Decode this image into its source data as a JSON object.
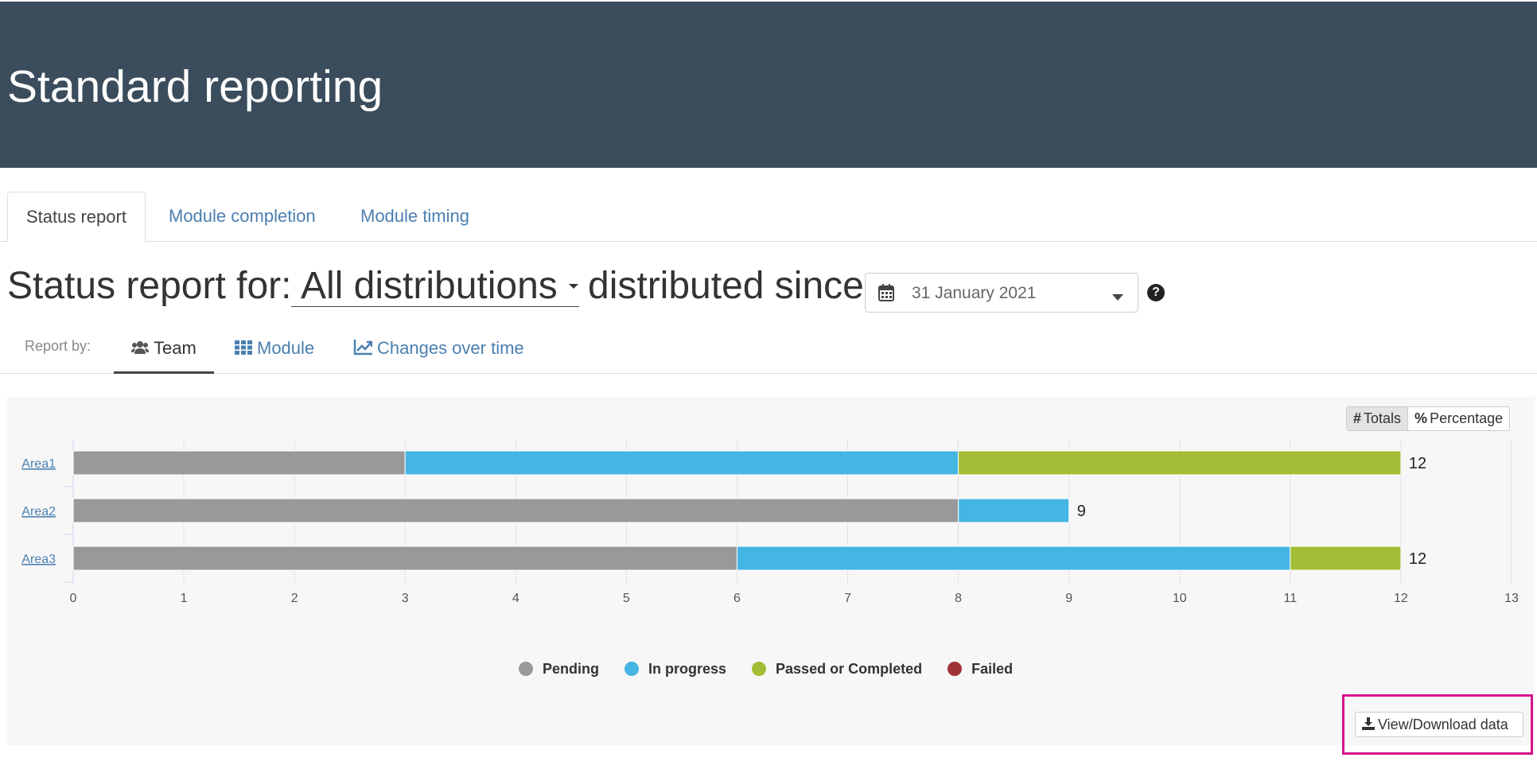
{
  "header": {
    "title": "Standard reporting"
  },
  "tabs": [
    {
      "label": "Status report",
      "active": true
    },
    {
      "label": "Module completion",
      "active": false
    },
    {
      "label": "Module timing",
      "active": false
    }
  ],
  "report": {
    "prefix": "Status report for:",
    "distribution": "All distributions",
    "since_label": "distributed since",
    "date": "31 January 2021"
  },
  "report_by": {
    "label": "Report by:",
    "items": [
      {
        "label": "Team",
        "icon": "users-icon",
        "active": true
      },
      {
        "label": "Module",
        "icon": "grid-icon",
        "active": false
      },
      {
        "label": "Changes over time",
        "icon": "line-chart-icon",
        "active": false
      }
    ]
  },
  "view_toggle": {
    "totals_symbol": "#",
    "totals": "Totals",
    "percent_symbol": "%",
    "percentage": "Percentage",
    "selected": "Totals"
  },
  "chart_data": {
    "type": "bar",
    "orientation": "horizontal",
    "stacked": true,
    "categories": [
      "Area1",
      "Area2",
      "Area3"
    ],
    "series": [
      {
        "name": "Pending",
        "color": "#999999",
        "values": [
          3,
          8,
          6
        ]
      },
      {
        "name": "In progress",
        "color": "#45b5e3",
        "values": [
          5,
          1,
          5
        ]
      },
      {
        "name": "Passed or Completed",
        "color": "#a3bd36",
        "values": [
          4,
          0,
          1
        ]
      },
      {
        "name": "Failed",
        "color": "#9e3436",
        "values": [
          0,
          0,
          0
        ]
      }
    ],
    "totals": [
      12,
      9,
      12
    ],
    "xlim": [
      0,
      13
    ],
    "xticks": [
      0,
      1,
      2,
      3,
      4,
      5,
      6,
      7,
      8,
      9,
      10,
      11,
      12,
      13
    ],
    "grid": true,
    "legend_position": "bottom"
  },
  "download": {
    "label": "View/Download data"
  }
}
